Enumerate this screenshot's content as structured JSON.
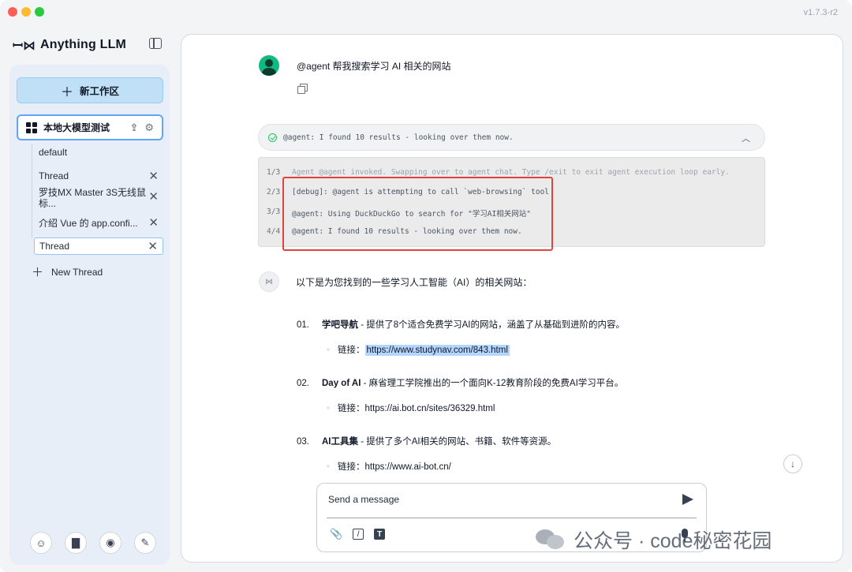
{
  "app": {
    "version": "v1.7.3-r2"
  },
  "brand": {
    "logo": "ꟷ⋈",
    "name": "Anything LLM"
  },
  "sidebar": {
    "new_workspace_label": "新工作区",
    "workspace": {
      "name": "本地大模型测试"
    },
    "threads": [
      {
        "label": "default",
        "closable": false
      },
      {
        "label": "Thread",
        "closable": true
      },
      {
        "label": "罗技MX Master 3S无线鼠标...",
        "closable": true
      },
      {
        "label": "介绍 Vue 的 app.confi...",
        "closable": true
      },
      {
        "label": "Thread",
        "closable": true,
        "active": true
      }
    ],
    "new_thread_label": "New Thread",
    "footer_icons": [
      "community-icon",
      "docs-book-icon",
      "discord-icon",
      "settings-wrench-icon"
    ]
  },
  "chat": {
    "user_message": "@agent 帮我搜索学习 AI 相关的网站",
    "agent_status": "@agent: I found 10 results - looking over them now.",
    "log": [
      {
        "num": "1/3",
        "text": "Agent @agent invoked. Swapping over to agent chat. Type /exit to exit agent execution loop early."
      },
      {
        "num": "2/3",
        "text": "[debug]: @agent is attempting to call `web-browsing` tool"
      },
      {
        "num": "3/3",
        "text": "@agent: Using DuckDuckGo to search for \"学习AI相关网站\""
      },
      {
        "num": "4/4",
        "text": "@agent: I found 10 results - looking over them now."
      }
    ],
    "bot_intro": "以下是为您找到的一些学习人工智能（AI）的相关网站：",
    "link_prefix": "链接：",
    "results": [
      {
        "num": "01.",
        "name": "学吧导航",
        "desc": " - 提供了8个适合免费学习AI的网站，涵盖了从基础到进阶的内容。",
        "url": "https://www.studynav.com/843.html"
      },
      {
        "num": "02.",
        "name": "Day of AI",
        "desc": " - 麻省理工学院推出的一个面向K-12教育阶段的免费AI学习平台。",
        "url": "https://ai.bot.cn/sites/36329.html"
      },
      {
        "num": "03.",
        "name": "AI工具集",
        "desc": " - 提供了多个AI相关的网站、书籍、软件等资源。",
        "url": "https://www.ai-bot.cn/"
      }
    ]
  },
  "composer": {
    "placeholder": "Send a message"
  },
  "watermark": {
    "text": "公众号 · code秘密花园"
  }
}
